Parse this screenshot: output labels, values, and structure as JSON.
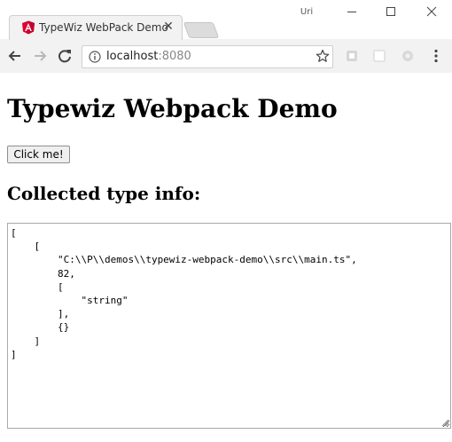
{
  "window": {
    "profile_name": "Uri",
    "controls": [
      "minimize-icon",
      "maximize-icon",
      "close-icon"
    ]
  },
  "tab": {
    "title": "TypeWiz WebPack Demo",
    "favicon": "angular-icon",
    "close_glyph": "✕"
  },
  "toolbar": {
    "url_host": "localhost",
    "url_port": ":8080",
    "icons": [
      "back-icon",
      "forward-icon",
      "reload-icon",
      "info-icon",
      "star-icon",
      "extension-icon",
      "menu-icon"
    ]
  },
  "page": {
    "title": "Typewiz Webpack Demo",
    "button_label": "Click me!",
    "section_title": "Collected type info:",
    "output": "[\n    [\n        \"C:\\\\P\\\\demos\\\\typewiz-webpack-demo\\\\src\\\\main.ts\",\n        82,\n        [\n            \"string\"\n        ],\n        {}\n    ]\n]"
  },
  "colors": {
    "chrome_bg": "#f2f2f2",
    "angular_red": "#dd0031",
    "text": "#000000"
  }
}
